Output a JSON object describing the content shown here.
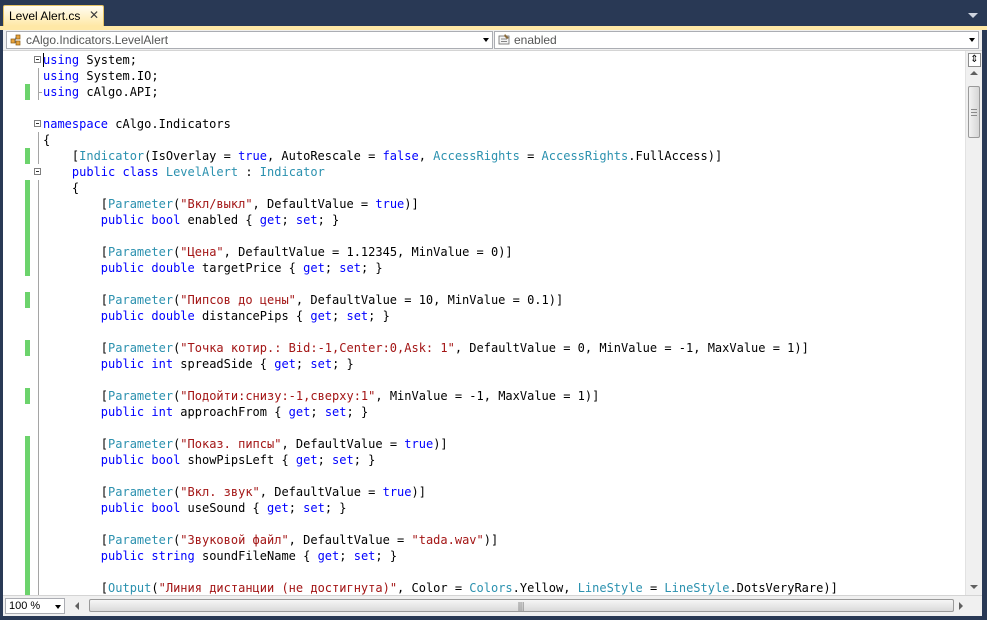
{
  "tab": {
    "title": "Level Alert.cs",
    "close_glyph": "✕"
  },
  "navbar": {
    "type_dropdown": {
      "value": "cAlgo.Indicators.LevelAlert",
      "icon": "class-icon"
    },
    "member_dropdown": {
      "value": "enabled",
      "icon": "property-icon"
    }
  },
  "colors": {
    "keyword": "#0000ff",
    "type": "#2b91af",
    "string": "#a31515",
    "change_bar": "#6cd36c",
    "frame": "#293955",
    "tab_active": "#ffe8a6"
  },
  "code_lines": [
    {
      "text": "using System;",
      "changed": false
    },
    {
      "text": "using System.IO;",
      "changed": false
    },
    {
      "text": "using cAlgo.API;",
      "changed": true
    },
    {
      "text": "",
      "changed": false
    },
    {
      "text": "namespace cAlgo.Indicators",
      "changed": false
    },
    {
      "text": "{",
      "changed": false
    },
    {
      "text": "    [Indicator(IsOverlay = true, AutoRescale = false, AccessRights = AccessRights.FullAccess)]",
      "changed": true
    },
    {
      "text": "    public class LevelAlert : Indicator",
      "changed": false
    },
    {
      "text": "    {",
      "changed": true
    },
    {
      "text": "        [Parameter(\"Вкл/выкл\", DefaultValue = true)]",
      "changed": true
    },
    {
      "text": "        public bool enabled { get; set; }",
      "changed": true
    },
    {
      "text": "",
      "changed": true
    },
    {
      "text": "        [Parameter(\"Цена\", DefaultValue = 1.12345, MinValue = 0)]",
      "changed": true
    },
    {
      "text": "        public double targetPrice { get; set; }",
      "changed": true
    },
    {
      "text": "",
      "changed": false
    },
    {
      "text": "        [Parameter(\"Пипсов до цены\", DefaultValue = 10, MinValue = 0.1)]",
      "changed": true
    },
    {
      "text": "        public double distancePips { get; set; }",
      "changed": false
    },
    {
      "text": "",
      "changed": false
    },
    {
      "text": "        [Parameter(\"Точка котир.: Bid:-1,Center:0,Ask: 1\", DefaultValue = 0, MinValue = -1, MaxValue = 1)]",
      "changed": true
    },
    {
      "text": "        public int spreadSide { get; set; }",
      "changed": false
    },
    {
      "text": "",
      "changed": false
    },
    {
      "text": "        [Parameter(\"Подойти:снизу:-1,сверху:1\", MinValue = -1, MaxValue = 1)]",
      "changed": true
    },
    {
      "text": "        public int approachFrom { get; set; }",
      "changed": false
    },
    {
      "text": "",
      "changed": false
    },
    {
      "text": "        [Parameter(\"Показ. пипсы\", DefaultValue = true)]",
      "changed": true
    },
    {
      "text": "        public bool showPipsLeft { get; set; }",
      "changed": true
    },
    {
      "text": "",
      "changed": true
    },
    {
      "text": "        [Parameter(\"Вкл. звук\", DefaultValue = true)]",
      "changed": true
    },
    {
      "text": "        public bool useSound { get; set; }",
      "changed": true
    },
    {
      "text": "",
      "changed": true
    },
    {
      "text": "        [Parameter(\"Звуковой файл\", DefaultValue = \"tada.wav\")]",
      "changed": true
    },
    {
      "text": "        public string soundFileName { get; set; }",
      "changed": true
    },
    {
      "text": "",
      "changed": true
    },
    {
      "text": "        [Output(\"Линия дистанции (не достигнута)\", Color = Colors.Yellow, LineStyle = LineStyle.DotsVeryRare)]",
      "changed": true
    }
  ],
  "zoom": {
    "value": "100 %"
  },
  "scrollbar": {
    "vertical_position": 0.08,
    "splitter_glyph": "⇕",
    "grip_glyph": "|||"
  }
}
